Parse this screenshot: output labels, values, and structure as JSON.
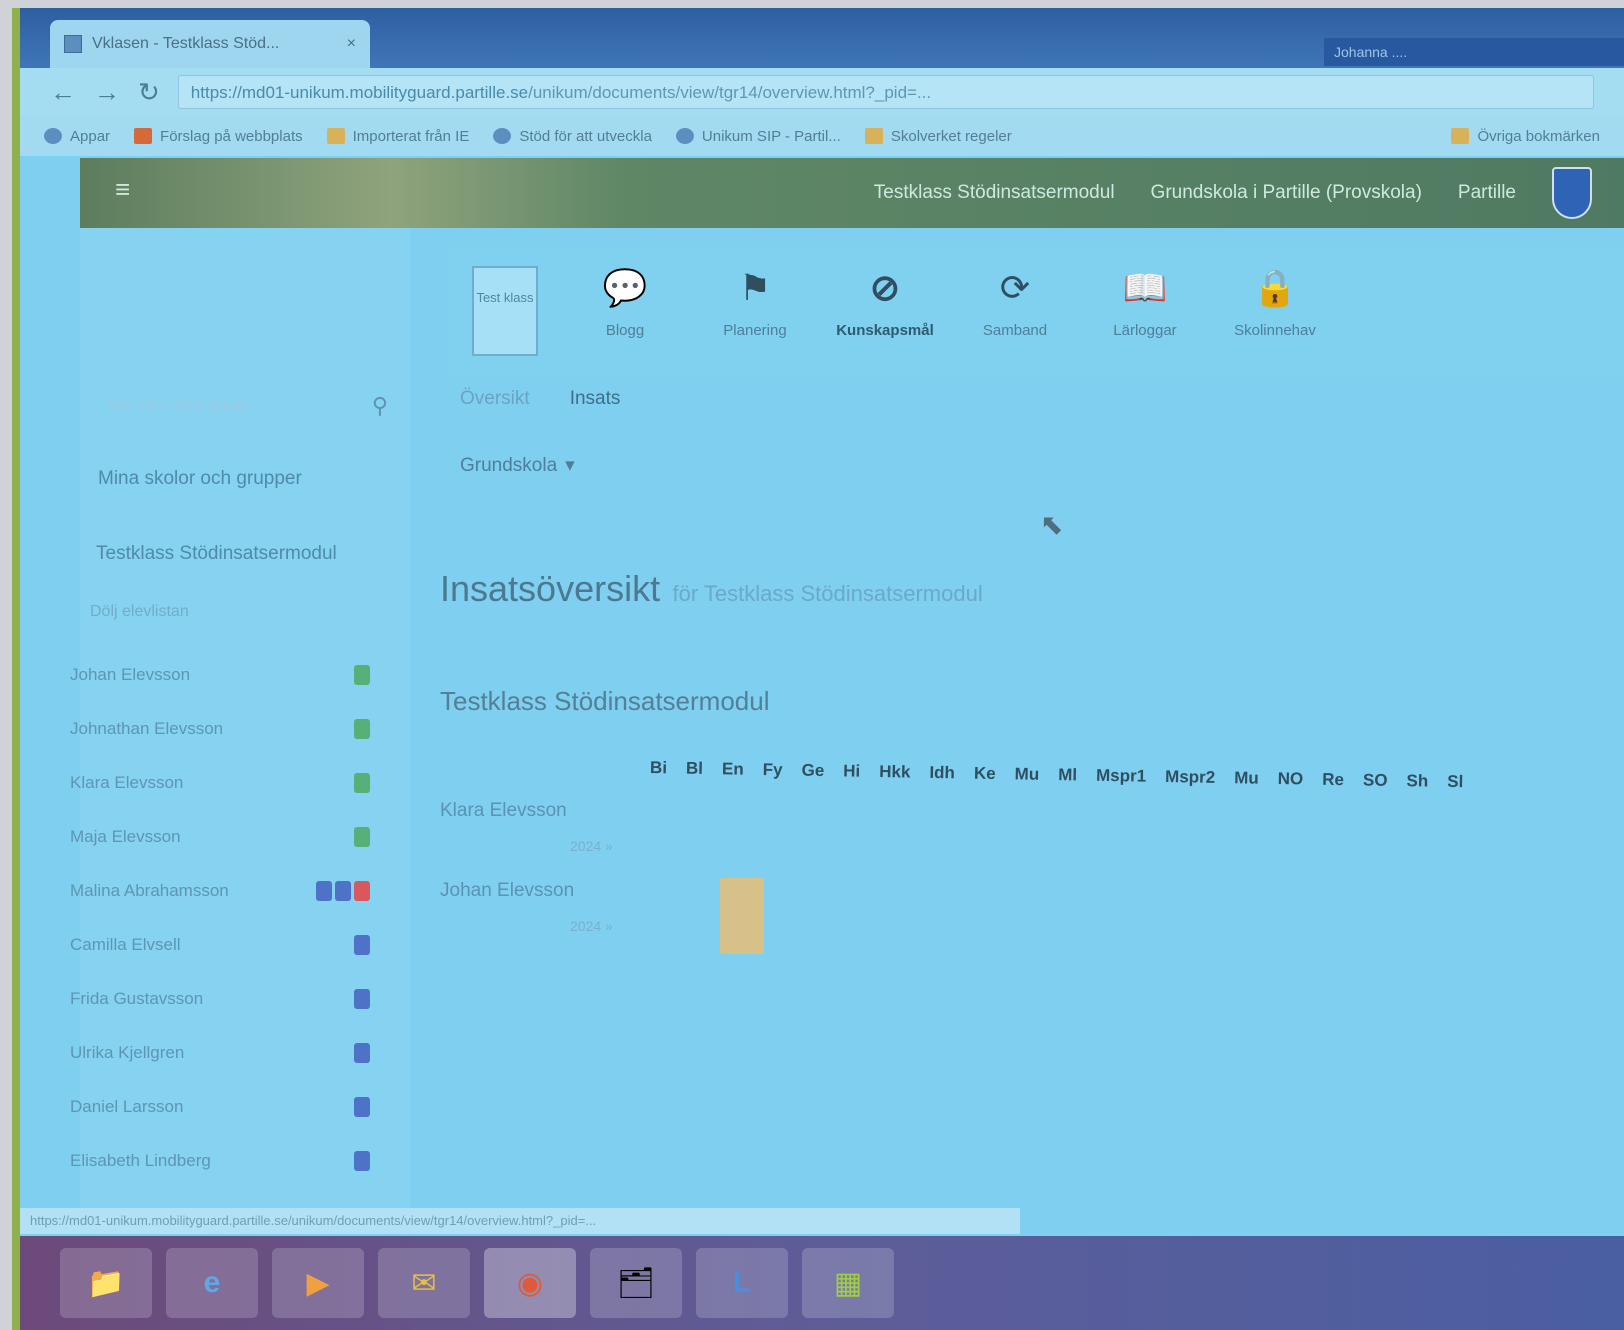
{
  "browser": {
    "tab_title": "Vklasen - Testklass Stöd...",
    "tab_close": "×",
    "window_title_text": "Johanna .... ",
    "back": "←",
    "forward": "→",
    "reload": "↻",
    "url_host": "https://md01-unikum.mobilityguard.partille.se",
    "url_path": "/unikum/documents/view/tgr14/overview.html?_pid=...",
    "bookmarks": [
      {
        "label": "Appar",
        "icon": "apps-icon"
      },
      {
        "label": "Förslag på webbplats",
        "icon": "suggested-sites-icon"
      },
      {
        "label": "Importerat från IE",
        "icon": "folder-icon"
      },
      {
        "label": "Stöd för att utveckla",
        "icon": "link-icon"
      },
      {
        "label": "Unikum SIP - Partil...",
        "icon": "globe-icon"
      },
      {
        "label": "Skolverket regeler",
        "icon": "page-icon"
      },
      {
        "label": "Övriga bokmärken",
        "icon": "folder-icon"
      }
    ]
  },
  "header": {
    "menu_icon": "hamburger-icon",
    "class_name": "Testklass Stödinsatsermodul",
    "school": "Grundskola i Partille (Provskola)",
    "municipality": "Partille"
  },
  "sidebar": {
    "search_placeholder": "Sök elev eller grupp",
    "my_link": "Mina skolor och grupper",
    "class_link": "Testklass Stödinsatsermodul",
    "hide_students": "Dölj elevlistan",
    "students": [
      {
        "name": "Johan Elevsson",
        "badges": [
          "green"
        ]
      },
      {
        "name": "Johnathan Elevsson",
        "badges": [
          "green"
        ]
      },
      {
        "name": "Klara Elevsson",
        "badges": [
          "green"
        ]
      },
      {
        "name": "Maja Elevsson",
        "badges": [
          "green"
        ]
      },
      {
        "name": "Malina Abrahamsson",
        "badges": [
          "blue",
          "blue",
          "red"
        ]
      },
      {
        "name": "Camilla Elvsell",
        "badges": [
          "blue"
        ]
      },
      {
        "name": "Frida Gustavsson",
        "badges": [
          "blue"
        ]
      },
      {
        "name": "Ulrika Kjellgren",
        "badges": [
          "blue"
        ]
      },
      {
        "name": "Daniel Larsson",
        "badges": [
          "blue"
        ]
      },
      {
        "name": "Elisabeth Lindberg",
        "badges": [
          "blue"
        ]
      }
    ]
  },
  "toolbar": {
    "card_label": "Test klass",
    "items": [
      {
        "label": "Blogg",
        "icon": "chat-bubble-icon",
        "glyph": "💬"
      },
      {
        "label": "Planering",
        "icon": "flag-icon",
        "glyph": "⚑"
      },
      {
        "label": "Kunskapsmål",
        "icon": "no-entry-icon",
        "glyph": "⊘"
      },
      {
        "label": "Samband",
        "icon": "refresh-icon",
        "glyph": "⟳"
      },
      {
        "label": "Lärloggar",
        "icon": "book-icon",
        "glyph": "📖"
      },
      {
        "label": "Skolinnehav",
        "icon": "lock-icon",
        "glyph": "🔒"
      }
    ]
  },
  "content": {
    "tabs": [
      "Översikt",
      "Insats"
    ],
    "dropdown": "Grundskola",
    "dropdown_caret": "▾",
    "title": "Insatsöversikt",
    "subtitle": "för Testklass Stödinsatsermodul",
    "class_title": "Testklass Stödinsatsermodul",
    "subjects": [
      "Bi",
      "Bl",
      "En",
      "Fy",
      "Ge",
      "Hi",
      "Hkk",
      "Idh",
      "Ke",
      "Mu",
      "Ml",
      "Mspr1",
      "Mspr2",
      "Mu",
      "NO",
      "Re",
      "SO",
      "Sh",
      "Sl"
    ],
    "rows": [
      {
        "name": "Klara Elevsson",
        "year": "2024 »"
      },
      {
        "name": "Johan Elevsson",
        "year": "2024 »"
      }
    ]
  },
  "status_bar": "https://md01-unikum.mobilityguard.partille.se/unikum/documents/view/tgr14/overview.html?_pid=...",
  "taskbar": [
    {
      "icon": "file-explorer-icon",
      "glyph": "📁"
    },
    {
      "icon": "internet-explorer-icon",
      "glyph": "e"
    },
    {
      "icon": "media-player-icon",
      "glyph": "▶"
    },
    {
      "icon": "outlook-icon",
      "glyph": "✉"
    },
    {
      "icon": "chrome-icon",
      "glyph": "◉"
    },
    {
      "icon": "explorer-icon",
      "glyph": "🗂"
    },
    {
      "icon": "lync-icon",
      "glyph": "L"
    },
    {
      "icon": "calendar-icon",
      "glyph": "▦"
    }
  ],
  "colors": {
    "green": "#57b077",
    "blue": "#4d72c8",
    "red": "#d8585e"
  }
}
